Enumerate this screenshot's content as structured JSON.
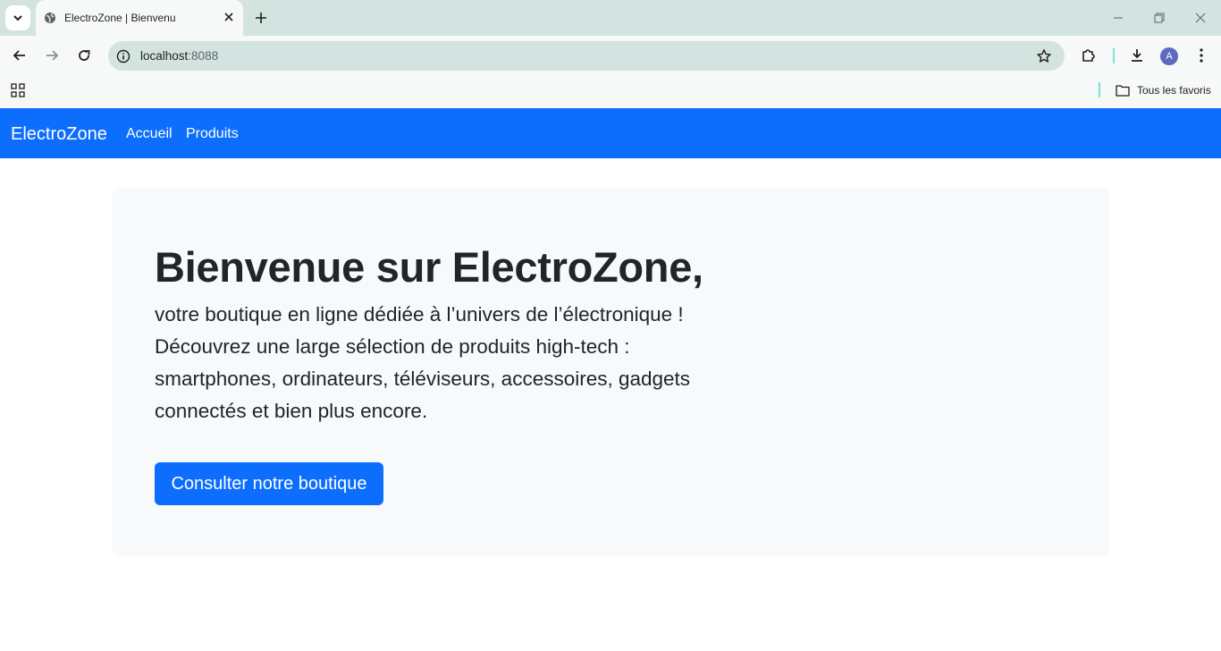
{
  "browser": {
    "tab_title": "ElectroZone | Bienvenu",
    "url_host": "localhost",
    "url_port": ":8088",
    "avatar_letter": "A",
    "bookmarks_all_label": "Tous les favoris"
  },
  "navbar": {
    "brand": "ElectroZone",
    "links": [
      {
        "label": "Accueil"
      },
      {
        "label": "Produits"
      }
    ],
    "color": "#0d6efd"
  },
  "hero": {
    "title": "Bienvenue sur ElectroZone,",
    "text": "votre boutique en ligne dédiée à l’univers de l’électronique ! Découvrez une large sélection de produits high-tech : smartphones, ordinateurs, téléviseurs, accessoires, gadgets connectés et bien plus encore.",
    "button_label": "Consulter notre boutique"
  },
  "icons": {
    "tab_search": "chevron-down-icon",
    "favicon": "globe-icon",
    "close": "close-icon",
    "new_tab": "plus-icon",
    "back": "back-arrow-icon",
    "forward": "forward-arrow-icon",
    "reload": "reload-icon",
    "site_info": "info-icon",
    "bookmark": "star-icon",
    "extensions": "puzzle-icon",
    "downloads": "download-icon",
    "menu": "kebab-menu-icon",
    "apps": "apps-grid-icon",
    "folder": "folder-icon"
  }
}
